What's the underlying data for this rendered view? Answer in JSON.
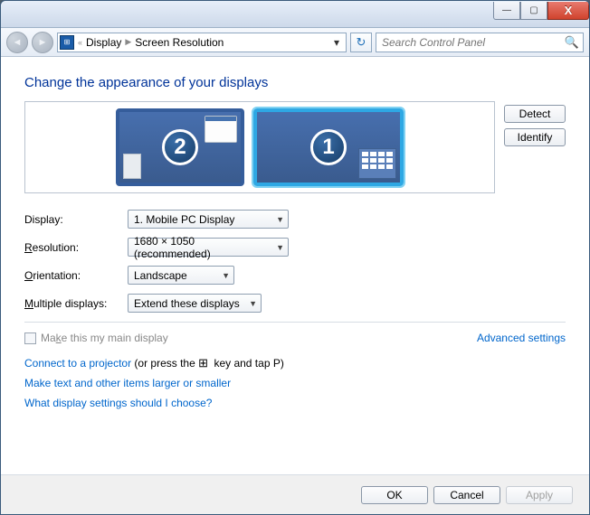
{
  "breadcrumb": {
    "level1": "Display",
    "level2": "Screen Resolution"
  },
  "search": {
    "placeholder": "Search Control Panel"
  },
  "heading": "Change the appearance of your displays",
  "buttons": {
    "detect": "Detect",
    "identify": "Identify",
    "ok": "OK",
    "cancel": "Cancel",
    "apply": "Apply"
  },
  "monitors": {
    "primary": "1",
    "secondary": "2"
  },
  "labels": {
    "display": "Display:",
    "resolution_pre": "R",
    "resolution_post": "esolution:",
    "orientation_pre": "O",
    "orientation_post": "rientation:",
    "multiple_pre": "M",
    "multiple_post": "ultiple displays:",
    "maindisplay_pre": "Ma",
    "maindisplay_mid": "k",
    "maindisplay_post": "e this my main display"
  },
  "values": {
    "display": "1. Mobile PC Display",
    "resolution": "1680 × 1050 (recommended)",
    "orientation": "Landscape",
    "multiple": "Extend these displays"
  },
  "links": {
    "advanced": "Advanced settings",
    "projector_link": "Connect to a projector",
    "projector_rest": " (or press the ",
    "projector_tail": " key and tap P)",
    "larger": "Make text and other items larger or smaller",
    "what": "What display settings should I choose?"
  }
}
